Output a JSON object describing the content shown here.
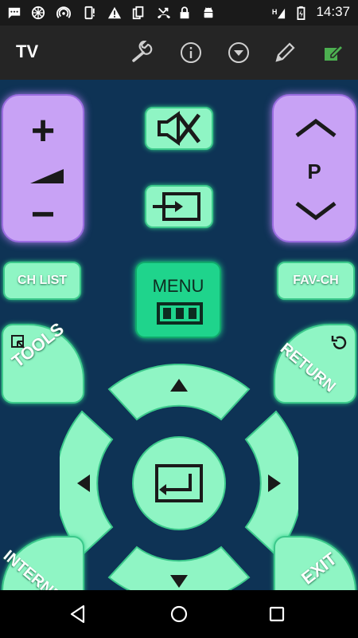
{
  "status_bar": {
    "time": "14:37",
    "icons": [
      "message-icon",
      "basketball-icon",
      "hotspot-icon",
      "phone-alert-icon",
      "warning-icon",
      "sim-icon",
      "missed-call-icon",
      "lock-icon",
      "android-icon",
      "h-network-icon",
      "battery-icon"
    ]
  },
  "app_bar": {
    "title": "TV",
    "actions": [
      "wrench-icon",
      "info-icon",
      "dropdown-icon",
      "pencil-icon",
      "edit-note-icon"
    ]
  },
  "remote": {
    "volume": {
      "plus": "+",
      "minus": "−"
    },
    "program": {
      "label": "P"
    },
    "ch_list_label": "CH LIST",
    "fav_ch_label": "FAV-CH",
    "menu_label": "MENU",
    "tools_label": "TOOLS",
    "return_label": "RETURN",
    "internet_label": "INTERNET",
    "exit_label": "EXIT"
  },
  "colors": {
    "remote_bg": "#0e3355",
    "green_button": "#8ff5c4",
    "purple_button": "#c8a2f5",
    "menu_button": "#1fd48c"
  }
}
